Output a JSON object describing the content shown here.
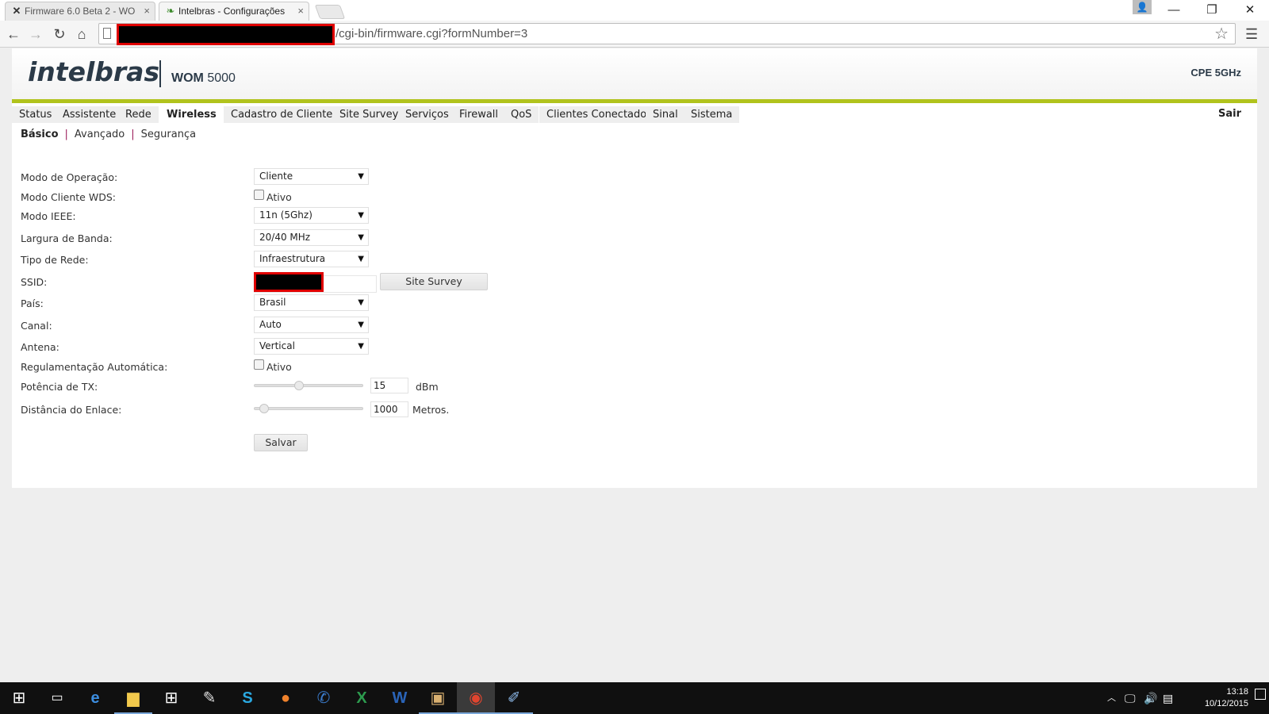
{
  "browser": {
    "tabs": [
      {
        "title": "Firmware 6.0 Beta 2 - WO",
        "active": false,
        "icon": "x-logo-icon"
      },
      {
        "title": "Intelbras - Configurações ",
        "active": true,
        "icon": "intelbras-leaf-icon"
      }
    ],
    "address_path": "/cgi-bin/firmware.cgi?formNumber=3",
    "window_controls": {
      "minimize": "—",
      "restore": "❐",
      "close": "✕"
    }
  },
  "header": {
    "logo": "intelbras",
    "model_prefix": "WOM",
    "model_number": "5000",
    "product_type": "CPE 5GHz"
  },
  "nav": {
    "items": [
      "Status",
      "Assistente",
      "Rede",
      "Wireless",
      "Cadastro de Clientes",
      "Site Survey",
      "Serviços",
      "Firewall",
      "QoS",
      "Clientes Conectados",
      "Sinal",
      "Sistema"
    ],
    "active": "Wireless",
    "logout": "Sair"
  },
  "subnav": {
    "items": [
      "Básico",
      "Avançado",
      "Segurança"
    ],
    "active": "Básico",
    "separator": "|"
  },
  "form": {
    "modo_operacao": {
      "label": "Modo de Operação:",
      "value": "Cliente"
    },
    "modo_wds": {
      "label": "Modo Cliente WDS:",
      "checkbox_label": "Ativo",
      "checked": false
    },
    "modo_ieee": {
      "label": "Modo IEEE:",
      "value": "11n (5Ghz)"
    },
    "largura_banda": {
      "label": "Largura de Banda:",
      "value": "20/40 MHz"
    },
    "tipo_rede": {
      "label": "Tipo de Rede:",
      "value": "Infraestrutura"
    },
    "ssid": {
      "label": "SSID:",
      "button": "Site Survey"
    },
    "pais": {
      "label": "País:",
      "value": "Brasil"
    },
    "canal": {
      "label": "Canal:",
      "value": "Auto"
    },
    "antena": {
      "label": "Antena:",
      "value": "Vertical"
    },
    "regulamentacao": {
      "label": "Regulamentação Automática:",
      "checkbox_label": "Ativo",
      "checked": false
    },
    "potencia": {
      "label": "Potência de TX:",
      "value": "15",
      "unit": "dBm",
      "slider_fraction": 0.4
    },
    "distancia": {
      "label": "Distância do Enlace:",
      "value": "1000",
      "unit": "Metros.",
      "slider_fraction": 0.05
    },
    "save": "Salvar"
  },
  "taskbar": {
    "apps": [
      "windows-start-icon",
      "task-view-icon",
      "edge-icon",
      "file-explorer-icon",
      "store-icon",
      "notepad-icon",
      "skype-icon",
      "firefox-icon",
      "phone-app-icon",
      "excel-icon",
      "word-icon",
      "media-app-icon",
      "chrome-icon",
      "paint-icon"
    ],
    "time": "13:18",
    "date": "10/12/2015"
  },
  "colors": {
    "accent_green": "#b1c31d",
    "brand_dark": "#2b3a48",
    "redaction": "#e00000"
  }
}
